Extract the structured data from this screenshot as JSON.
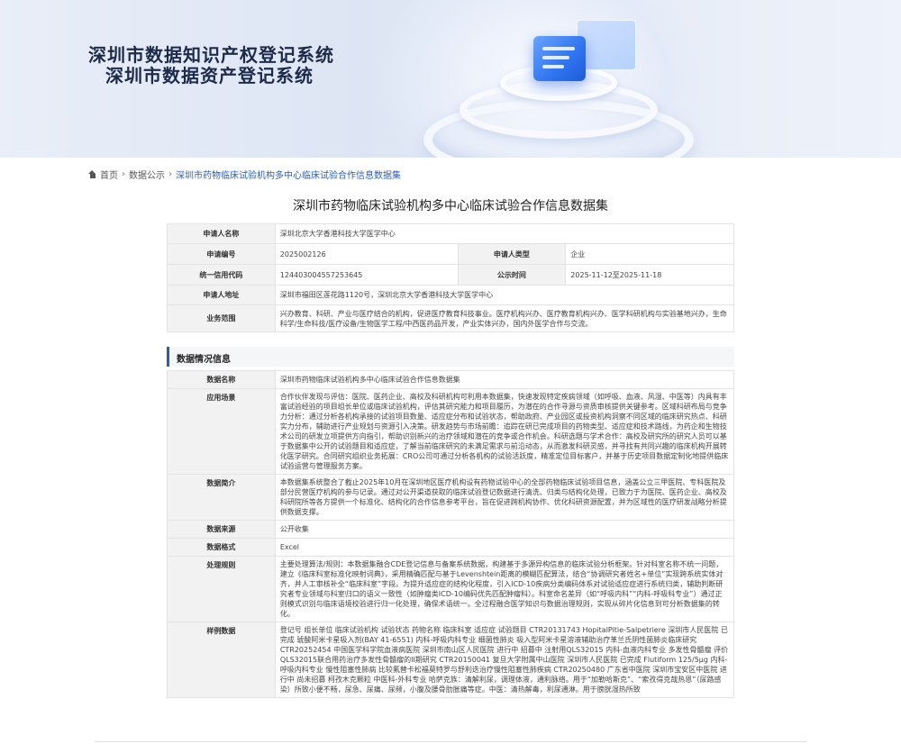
{
  "banner": {
    "title_line1": "深圳市数据知识产权登记系统",
    "title_line2": "深圳市数据资产登记系统"
  },
  "breadcrumb": {
    "home": "首页",
    "level1": "数据公示",
    "current": "深圳市药物临床试验机构多中心临床试验合作信息数据集"
  },
  "page_title": "深圳市药物临床试验机构多中心临床试验合作信息数据集",
  "basic_info": {
    "applicant_name_label": "申请人名称",
    "applicant_name": "深圳北京大学香港科技大学医学中心",
    "application_no_label": "申请编号",
    "application_no": "2025002126",
    "applicant_type_label": "申请人类型",
    "applicant_type": "企业",
    "credit_code_label": "统一信用代码",
    "credit_code": "12440300455725364​5",
    "notice_period_label": "公示时间",
    "notice_period": "2025-11-12至2025-11-18",
    "address_label": "申请人地址",
    "address": "深圳市福田区莲花路1120号，深圳北京大学香港科技大学医学中心",
    "business_scope_label": "业务范围",
    "business_scope": "兴办教育、科研、产业与医疗结合的机构，促进医疗教育科技事业。医疗机构兴办、医疗教育机构兴办、医学科研机构与实验基地兴办，生命科学/生命科技/医疗设备/生物医学工程/中西医药品开发，产业实体兴办，国内外医学合作与交流。"
  },
  "dataset_section": {
    "heading": "数据情况信息",
    "name_label": "数据名称",
    "name": "深圳市药物临床试验机构多中心临床试验合作信息数据集",
    "scenario_label": "应用场景",
    "scenario": "合作伙伴发现与评估：医院、医药企业、高校及科研机构可利用本数据集，快速发现特定疾病领域（如呼吸、血液、风湿、中医等）内具有丰富试验经验的项目组长单位或临床试验机构，评估其研究能力和项目履历，为潜在的合作寻源与资质审核提供关键参考。区域科研布局与竞争力分析：通过分析各机构承接的试验项目数量、适应症分布和试验状态，帮助政府、产业园区或投资机构洞察不同区域的临床研究热点、科研实力分布，辅助进行产业规划与资源引入决策。研发趋势与市场前瞻：追踪在研已完成项目的药物类型、适应症和技术路线，为药企和生物技术公司的研发立项提供方向指引，帮助识别新兴的治疗领域和潜在的竞争或合作机会。科研选题与学术合作：高校及研究所的研究人员可以基于数据集中公开的试验题目和适应症，了解当前临床研究的未满足需求与前沿动态，从而激发科研灵感，并寻找有共同兴趣的临床机构开展转化医学研究。合同研究组织业务拓展：CRO公司可通过分析各机构的试验活跃度，精准定位目标客户，并基于历史项目数据定制化地提供临床试验运营与管理服务方案。",
    "summary_label": "数据简介",
    "summary": "本数据集系统整合了截止2025年10月在深圳地区医疗机构设有药物试验中心的全部药物临床试验项目信息，涵盖公立三甲医院、专科医院及部分民营医疗机构的参与记录。通过对公开渠道获取的临床试验登记数据进行清洗、归类与结构化处理，已致力于为医院、医药企业、高校及科研院所等各方提供一个标准化、结构化的合作信息参考平台，旨在促进跨机构协作、优化科研资源配置，并为区域性的医疗研发战略分析提供数据支撑。",
    "source_label": "数据来源",
    "source": "公开收集",
    "format_label": "数据格式",
    "format": "Excel",
    "rules_label": "处理规则",
    "rules": "主要处理算法/规则：本数据集融合CDE登记信息与备案系统数据，构建基于多源异构信息的临床试验分析框架。针对科室名称不统一问题，建立《临床科室标准化映射词典》，采用精确匹配与基于Levenshtein距离的模糊匹配算法，结合“协调研究者姓名+单位”实现跨系统实体对齐，并人工审核补全“临床科室”字段。为提升适应症的结构化程度，引入ICD-10疾病分类编码体系对试验适应症进行系统归类，辅助判断研究者专业领域与科室归口的语义一致性（如肿瘤类ICD-10编码优先匹配肿瘤科）。科室命名差异（如“呼吸内科”“内科-呼吸科专业”）通过正则模式识别与临床语境校验进行归一化处理，确保术语统一。全过程融合医学知识与数据治理规则，实现从碎片化信息到可分析数据集的转化。",
    "sample_label": "样例数据",
    "sample": "登记号 组长单位 临床试验机构 试验状态 药物名称 临床科室 适应症 试验题目 CTR20131743 HopitalPitie-Salpetriere 深圳市人民医院 已完成 琥酸阿米卡星吸入剂(BAY 41-6551) 内科-呼吸内科专业 细菌性肺炎 吸入型阿米卡星溶液辅助治疗革兰氏阴性菌肺炎临床研究 CTR20252454 中国医学科学院血液病医院 深圳市南山区人民医院 进行中 招募中 注射用QLS32015 内科-血液内科专业 多发性骨髓瘤 评价QLS32015联合用药治疗多发性骨髓瘤的II期研究 CTR20150041 复旦大学附属中山医院 深圳市人民医院 已完成 Flutiform 125/5μg 内科-呼吸内科专业 慢性阻塞性肺病 比较氟替卡松福莫特罗与舒利迭治疗慢性阻塞性肺疾病 CTR20250480 广东省中医院 深圳市宝安区中医院 进行中 尚未招募 柯孜木克颗粒 中医科-外科专业 哈萨克族：清解利尿，调理体液，通利脉络。用于“加勒哈斯克”、“索孜得克哉热恩”（尿路感染）所致小便不畅，尿急、尿痛、尿频，小腹及腰骨肋胀痛等症。中医：清热解毒，利尿通淋。用于膀胱湿热所致"
  }
}
